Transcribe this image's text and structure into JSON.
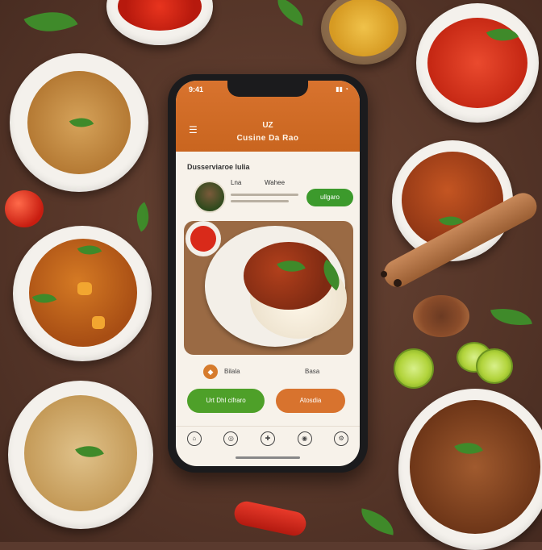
{
  "phone": {
    "status_time": "9:41",
    "status_icons": "▮▮ ◔",
    "header_small": "UZ",
    "header_title": "Cusine Da Rao",
    "section_title": "Dusserviaroe lulia",
    "profile_name": "Lna",
    "profile_tag": "Wahee",
    "follow_label": "ullgaro",
    "meta_icon": "◆",
    "meta_text": "Bilala",
    "meta_right": "Basa",
    "btn_green": "Urt Dhl cifraro",
    "btn_orange": "Atosdia",
    "nav_icons": [
      "⌂",
      "◎",
      "✚",
      "◉",
      "⚙"
    ]
  },
  "colors": {
    "accent_orange": "#d8732e",
    "accent_green": "#4ea029",
    "table": "#5a3a2e"
  }
}
